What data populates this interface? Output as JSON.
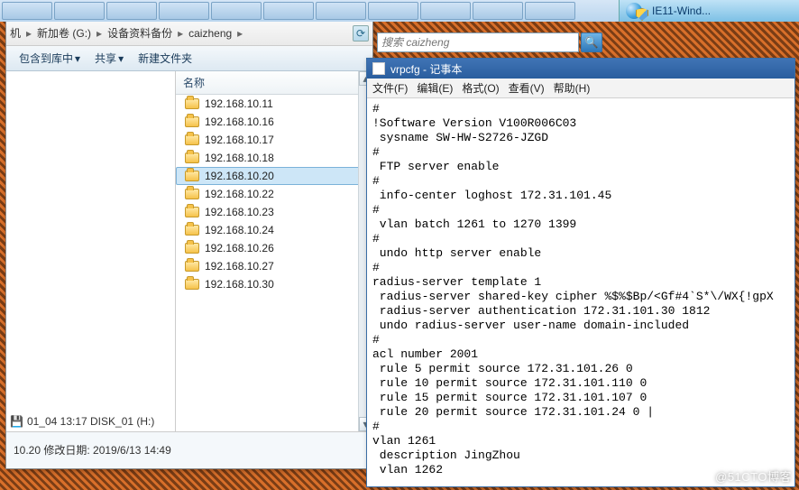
{
  "taskbar": {
    "ie_label": "IE11-Wind..."
  },
  "explorer": {
    "address": {
      "c0": "机",
      "c1": "新加卷 (G:)",
      "c2": "设备资料备份",
      "c3": "caizheng"
    },
    "commands": {
      "include": "包含到库中",
      "share": "共享",
      "newfolder": "新建文件夹"
    },
    "list_header": "名称",
    "files": [
      "192.168.10.11",
      "192.168.10.16",
      "192.168.10.17",
      "192.168.10.18",
      "192.168.10.20",
      "192.168.10.22",
      "192.168.10.23",
      "192.168.10.24",
      "192.168.10.26",
      "192.168.10.27",
      "192.168.10.30"
    ],
    "selected_index": 4,
    "tree_bottom": "01_04 13:17 DISK_01 (H:)",
    "status_line1": "10.20 修改日期: 2019/6/13 14:49"
  },
  "search": {
    "placeholder": "搜索 caizheng"
  },
  "notepad": {
    "title": "vrpcfg - 记事本",
    "menu": {
      "file": "文件(F)",
      "edit": "编辑(E)",
      "format": "格式(O)",
      "view": "查看(V)",
      "help": "帮助(H)"
    },
    "content_lines": [
      "#",
      "!Software Version V100R006C03",
      " sysname SW-HW-S2726-JZGD",
      "#",
      " FTP server enable",
      "#",
      " info-center loghost 172.31.101.45",
      "#",
      " vlan batch 1261 to 1270 1399",
      "#",
      " undo http server enable",
      "#",
      "radius-server template 1",
      " radius-server shared-key cipher %$%$Bp/<Gf#4`S*\\/WX{!gpX",
      " radius-server authentication 172.31.101.30 1812",
      " undo radius-server user-name domain-included",
      "#",
      "acl number 2001",
      " rule 5 permit source 172.31.101.26 0",
      " rule 10 permit source 172.31.101.110 0",
      " rule 15 permit source 172.31.101.107 0",
      " rule 20 permit source 172.31.101.24 0 |",
      "#",
      "vlan 1261",
      " description JingZhou",
      " vlan 1262"
    ]
  },
  "watermark": "@51CTO博客"
}
